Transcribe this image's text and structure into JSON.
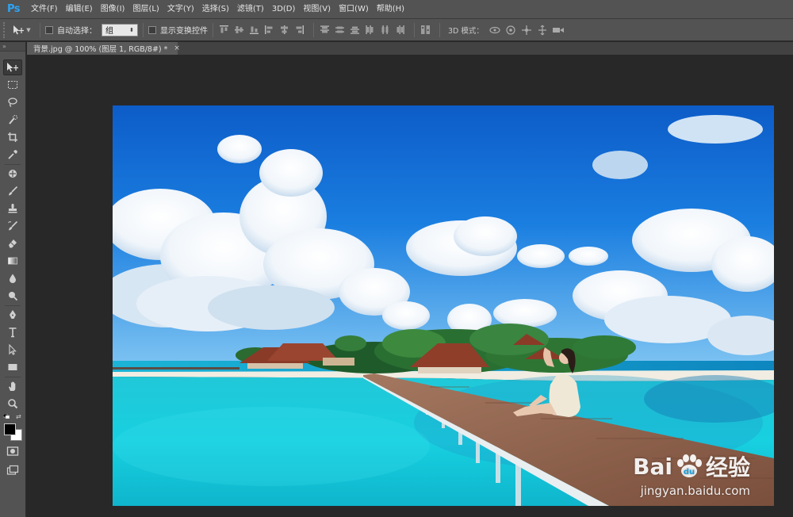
{
  "app": {
    "logo": "Ps"
  },
  "menu": [
    "文件(F)",
    "编辑(E)",
    "图像(I)",
    "图层(L)",
    "文字(Y)",
    "选择(S)",
    "滤镜(T)",
    "3D(D)",
    "视图(V)",
    "窗口(W)",
    "帮助(H)"
  ],
  "options": {
    "auto_select_label": "自动选择：",
    "auto_select_value": "组",
    "show_transform_label": "显示变换控件",
    "mode_3d_label": "3D 模式："
  },
  "document_tab": {
    "title": "背景.jpg @ 100% (图层 1, RGB/8#) *",
    "close": "×"
  },
  "toolbar": {
    "collapse": "»"
  },
  "watermark": {
    "brand_left": "Bai",
    "brand_right": "经验",
    "url": "jingyan.baidu.com"
  },
  "colors": {
    "foreground": "#000000",
    "background": "#ffffff",
    "accent": "#2fa3f2",
    "chrome": "#535353",
    "workspace": "#282828"
  }
}
